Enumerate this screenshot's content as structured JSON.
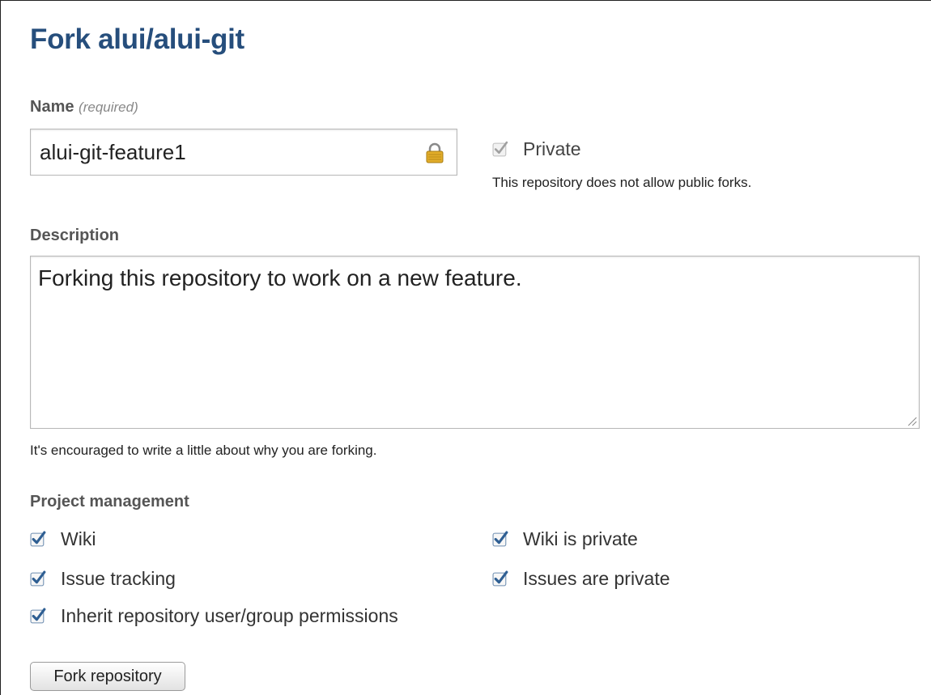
{
  "form": {
    "title": "Fork alui/alui-git",
    "name_label": "Name",
    "name_hint": "(required)",
    "name_value": "alui-git-feature1",
    "private_label": "Private",
    "private_checked": true,
    "private_note": "This repository does not allow public forks.",
    "description_label": "Description",
    "description_value": "Forking this repository to work on a new feature.",
    "description_note": "It's encouraged to write a little about why you are forking.",
    "project_management_label": "Project management",
    "options": {
      "wiki": "Wiki",
      "wiki_private": "Wiki is private",
      "issue_tracking": "Issue tracking",
      "issues_private": "Issues are private",
      "inherit_permissions": "Inherit repository user/group permissions"
    },
    "submit_label": "Fork repository"
  },
  "icons": {
    "lock": "lock-icon",
    "checkbox": "checkbox-checked-icon",
    "resize": "resize-grip-icon"
  },
  "colors": {
    "title": "#264e7c",
    "checkbox_fill": "#2f5f93",
    "lock": "#d9a520"
  }
}
